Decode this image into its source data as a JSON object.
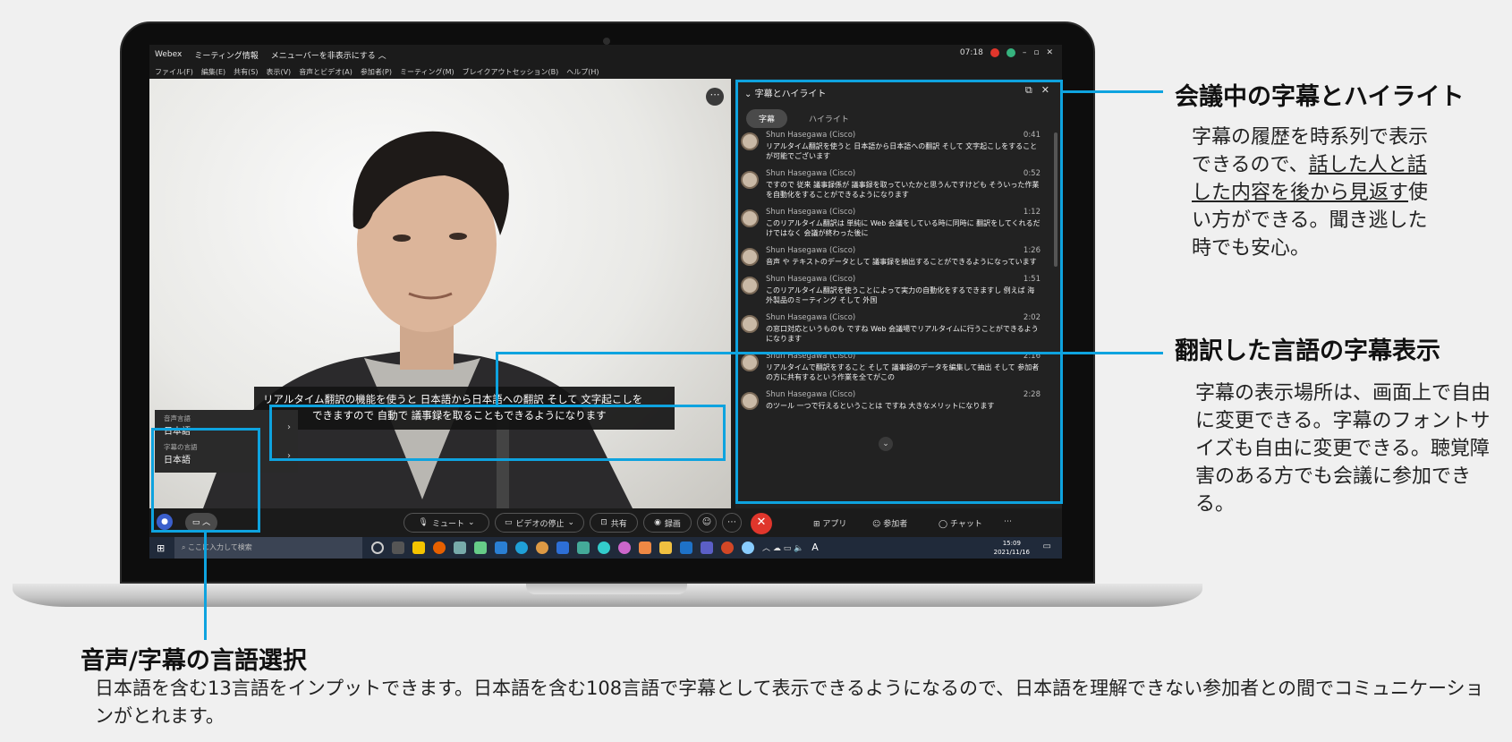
{
  "window": {
    "app_name": "Webex",
    "meeting_info": "ミーティング情報",
    "menubar_toggle": "メニューバーを非表示にする ︿",
    "time": "07:18",
    "menu": [
      "ファイル(F)",
      "編集(E)",
      "共有(S)",
      "表示(V)",
      "音声とビデオ(A)",
      "参加者(P)",
      "ミーティング(M)",
      "ブレイクアウトセッション(B)",
      "ヘルプ(H)"
    ]
  },
  "caption_panel": {
    "title": "字幕とハイライト",
    "tabs": [
      "字幕",
      "ハイライト"
    ],
    "entries": [
      {
        "name": "Shun Hasegawa (Cisco)",
        "time": "0:41",
        "text": "リアルタイム翻訳を使うと 日本語から日本語への翻訳 そして 文字起こしをすることが可能でございます"
      },
      {
        "name": "Shun Hasegawa (Cisco)",
        "time": "0:52",
        "text": "ですので 従来 議事録係が 議事録を取っていたかと思うんですけども そういった作業を自動化をすることができるようになります"
      },
      {
        "name": "Shun Hasegawa (Cisco)",
        "time": "1:12",
        "text": "このリアルタイム翻訳は 単純に Web 会議をしている時に同時に 翻訳をしてくれるだけではなく 会議が終わった後に"
      },
      {
        "name": "Shun Hasegawa (Cisco)",
        "time": "1:26",
        "text": "音声 や テキストのデータとして 議事録を抽出することができるようになっています"
      },
      {
        "name": "Shun Hasegawa (Cisco)",
        "time": "1:51",
        "text": "このリアルタイム翻訳を使うことによって実力の自動化をするできますし 例えば 海外製品のミーティング そして 外国"
      },
      {
        "name": "Shun Hasegawa (Cisco)",
        "time": "2:02",
        "text": "の窓口対応というものも ですね Web 会議場でリアルタイムに行うことができるようになります"
      },
      {
        "name": "Shun Hasegawa (Cisco)",
        "time": "2:16",
        "text": "リアルタイムで翻訳をすること そして 議事録のデータを編集して抽出 そして 参加者の方に共有するという作業を全てがこの"
      },
      {
        "name": "Shun Hasegawa (Cisco)",
        "time": "2:28",
        "text": "のツール 一つで行えるということは ですね 大きなメリットになります"
      }
    ]
  },
  "subtitle": {
    "line1": "リアルタイム翻訳の機能を使うと 日本語から日本語への翻訳 そして 文字起こしを",
    "line2": "できますので 自動で 議事録を取ることもできるようになります"
  },
  "language_menu": {
    "audio_label": "音声言語",
    "audio_value": "日本語",
    "caption_label": "字幕の言語",
    "caption_value": "日本語"
  },
  "controls": {
    "mute": "ミュート",
    "video_stop": "ビデオの停止",
    "share": "共有",
    "record": "録画",
    "apps": "アプリ",
    "participants": "参加者",
    "chat": "チャット"
  },
  "taskbar": {
    "search_placeholder": "ここに入力して検索",
    "clock_time": "15:09",
    "clock_date": "2021/11/16",
    "ime": "A"
  },
  "annotations": {
    "a1_title": "会議中の字幕とハイライト",
    "a1_body_1": "字幕の履歴を時系列で表示",
    "a1_body_2a": "できるので、",
    "a1_body_2b": "話した人と話",
    "a1_body_3a": "した内容を後から見返す",
    "a1_body_3b": "使",
    "a1_body_4": "い方ができる。聞き逃した",
    "a1_body_5": "時でも安心。",
    "a2_title": "翻訳した言語の字幕表示",
    "a2_body": "字幕の表示場所は、画面上で自由に変更できる。字幕のフォントサイズも自由に変更できる。聴覚障害のある方でも会議に参加できる。",
    "a3_title": "音声/字幕の言語選択",
    "a3_body": "日本語を含む13言語をインプットできます。日本語を含む108言語で字幕として表示できるようになるので、日本語を理解できない参加者との間でコミュニケーションがとれます。"
  },
  "colors": {
    "highlight": "#0ea3df",
    "end_call": "#e0362c"
  }
}
